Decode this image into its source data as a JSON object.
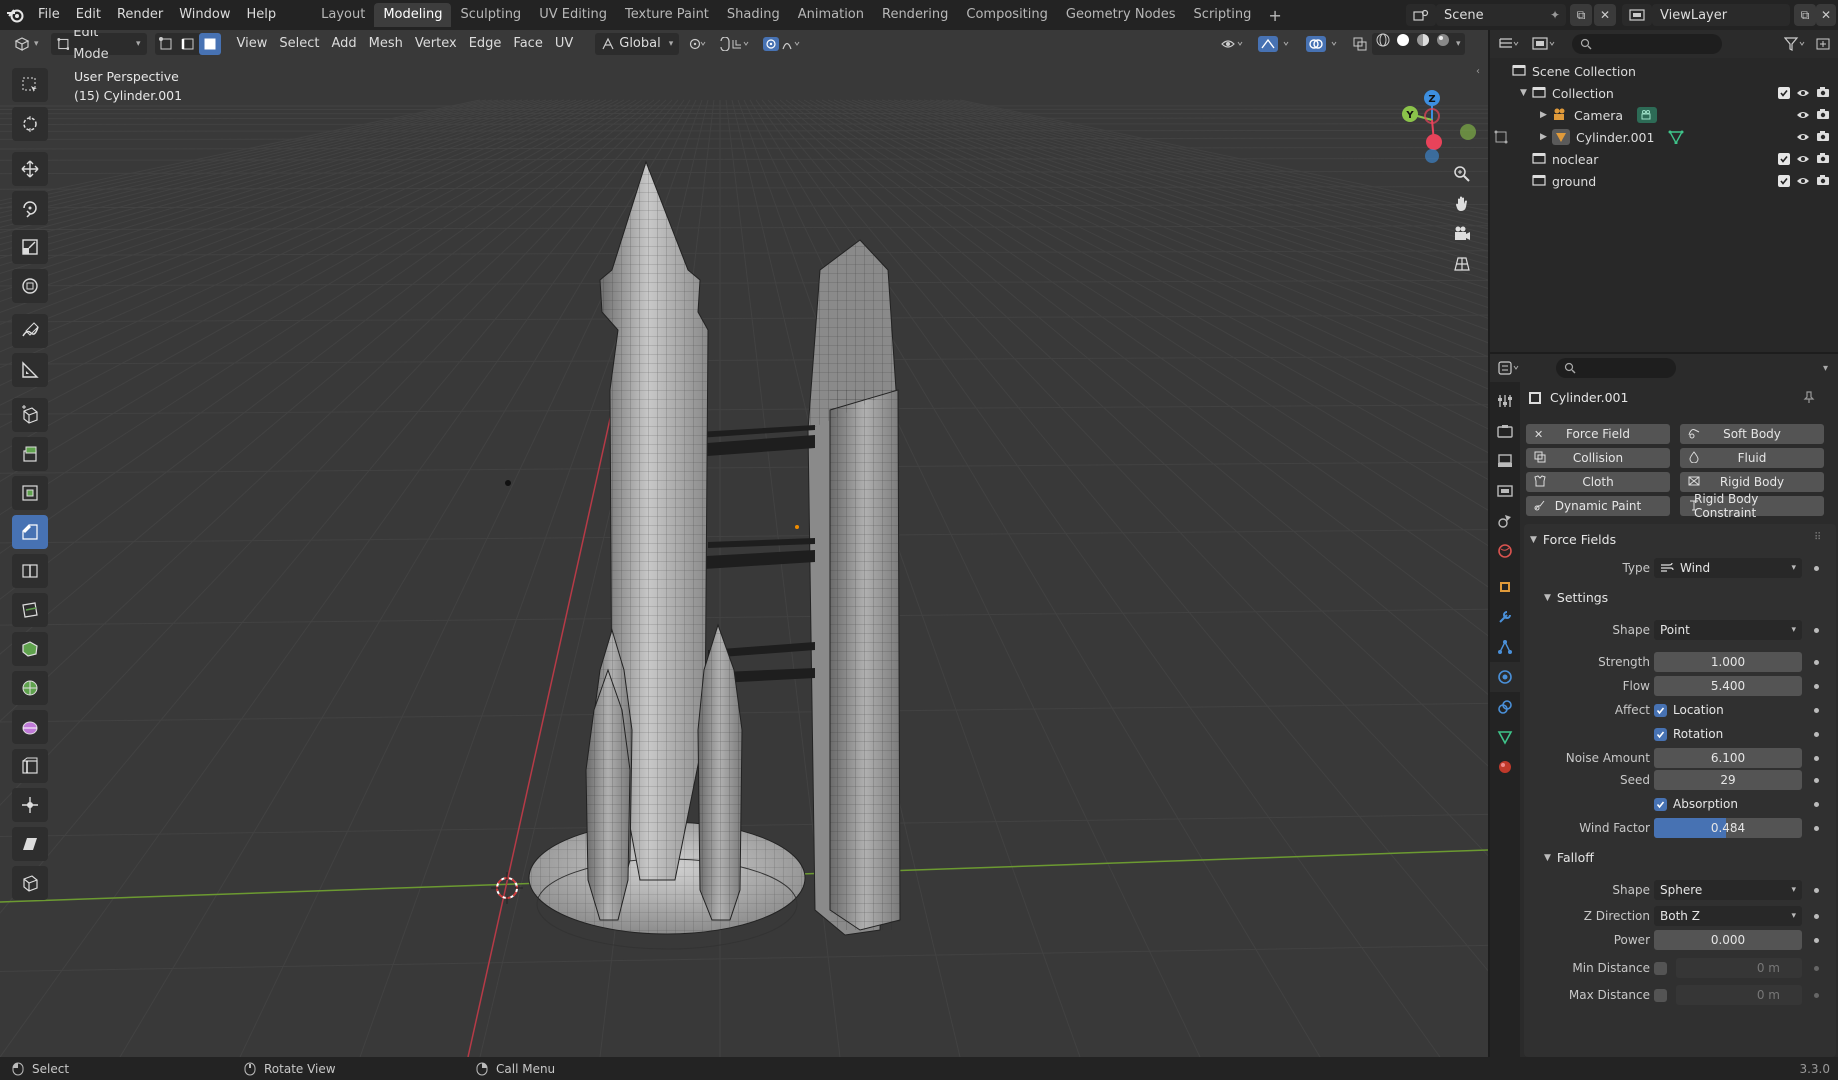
{
  "menu": [
    "File",
    "Edit",
    "Render",
    "Window",
    "Help"
  ],
  "workspaces": [
    "Layout",
    "Modeling",
    "Sculpting",
    "UV Editing",
    "Texture Paint",
    "Shading",
    "Animation",
    "Rendering",
    "Compositing",
    "Geometry Nodes",
    "Scripting"
  ],
  "workspace_active": "Modeling",
  "scene": "Scene",
  "view_layer": "ViewLayer",
  "viewport": {
    "mode": "Edit Mode",
    "menus": [
      "View",
      "Select",
      "Add",
      "Mesh",
      "Vertex",
      "Edge",
      "Face",
      "UV"
    ],
    "orientation": "Global",
    "info_line1": "User Perspective",
    "info_line2": "(15) Cylinder.001",
    "gizmo_x": "X",
    "gizmo_y": "Y",
    "gizmo_z": "Z"
  },
  "outliner": {
    "root": "Scene Collection",
    "items": [
      {
        "label": "Collection",
        "icon": "collection-icon"
      },
      {
        "label": "Camera",
        "icon": "camera-icon"
      },
      {
        "label": "Cylinder.001",
        "icon": "mesh-icon"
      },
      {
        "label": "noclear",
        "icon": "collection-icon"
      },
      {
        "label": "ground",
        "icon": "collection-icon"
      }
    ]
  },
  "properties": {
    "object_name": "Cylinder.001",
    "physics_buttons": [
      "Force Field",
      "Soft Body",
      "Collision",
      "Fluid",
      "Cloth",
      "Rigid Body",
      "Dynamic Paint",
      "Rigid Body Constraint"
    ],
    "force_fields_title": "Force Fields",
    "type_label": "Type",
    "type_value": "Wind",
    "settings_title": "Settings",
    "shape_label": "Shape",
    "shape_value": "Point",
    "strength_label": "Strength",
    "strength_value": "1.000",
    "flow_label": "Flow",
    "flow_value": "5.400",
    "affect_label": "Affect",
    "location_label": "Location",
    "rotation_label": "Rotation",
    "noise_label": "Noise Amount",
    "noise_value": "6.100",
    "seed_label": "Seed",
    "seed_value": "29",
    "absorption_label": "Absorption",
    "wind_factor_label": "Wind Factor",
    "wind_factor_value": "0.484",
    "wind_factor_fraction": 0.484,
    "falloff_title": "Falloff",
    "falloff_shape_label": "Shape",
    "falloff_shape_value": "Sphere",
    "zdir_label": "Z Direction",
    "zdir_value": "Both Z",
    "power_label": "Power",
    "power_value": "0.000",
    "min_dist_label": "Min Distance",
    "min_dist_value": "0 m",
    "max_dist_label": "Max Distance",
    "max_dist_value": "0 m"
  },
  "status": {
    "select": "Select",
    "rotate": "Rotate View",
    "menu": "Call Menu",
    "version": "3.3.0"
  },
  "colors": {
    "accent": "#4772b3",
    "axis_x": "#e8435a",
    "axis_y": "#8bc34a",
    "axis_z": "#3d8fe0"
  }
}
